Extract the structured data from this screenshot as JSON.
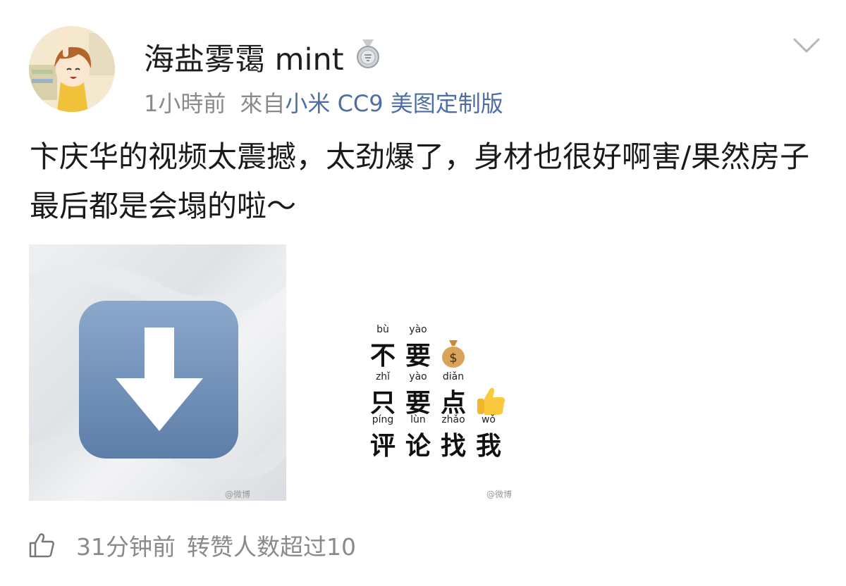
{
  "post": {
    "username": "海盐雾霭 mint",
    "time": "1小時前",
    "source_prefix": "來自",
    "source_device": "小米 CC9 美图定制版",
    "text": "卞庆华的视频太震撼，太劲爆了，身材也很好啊害/果然房子最后都是会塌的啦～"
  },
  "images": [
    {
      "icon": "download-arrow-emoji",
      "watermark": "@微博"
    },
    {
      "promo_lines": [
        {
          "pinyin": [
            "bù",
            "yào"
          ],
          "chars": [
            "不",
            "要"
          ],
          "emoji": "money-bag-emoji"
        },
        {
          "pinyin": [
            "zhǐ",
            "yào",
            "diǎn"
          ],
          "chars": [
            "只",
            "要",
            "点"
          ],
          "emoji": "thumbs-up-emoji"
        },
        {
          "pinyin": [
            "píng",
            "lùn",
            "zhǎo",
            "wǒ"
          ],
          "chars": [
            "评",
            "论",
            "找",
            "我"
          ],
          "emoji": ""
        }
      ],
      "watermark": "@微博"
    }
  ],
  "footer": {
    "icon": "like-icon",
    "time": "31分钟前",
    "text": "转赞人数超过10"
  },
  "colors": {
    "link": "#4e6fa3",
    "meta": "#8a8a8a",
    "arrow_box": "#6f8fb6"
  }
}
